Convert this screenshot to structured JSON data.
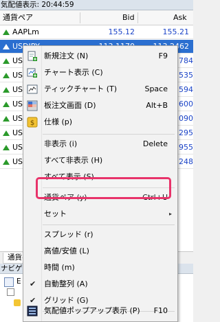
{
  "window": {
    "title": "気配値表示: 20:44:59"
  },
  "table": {
    "columns": [
      "通貨ペア",
      "Bid",
      "Ask"
    ],
    "rows": [
      {
        "symbol": "AAPLm",
        "bid": "155.12",
        "ask": "155.21",
        "selected": false
      },
      {
        "symbol": "USDJPY",
        "bid": "113.1170",
        "ask": "113.2462",
        "selected": true
      },
      {
        "symbol": "US",
        "bid": "",
        "ask": "784",
        "selected": false
      },
      {
        "symbol": "US",
        "bid": "",
        "ask": "535",
        "selected": false
      },
      {
        "symbol": "US",
        "bid": "",
        "ask": "594",
        "selected": false
      },
      {
        "symbol": "US",
        "bid": "",
        "ask": "600",
        "selected": false
      },
      {
        "symbol": "US",
        "bid": "",
        "ask": "090",
        "selected": false
      },
      {
        "symbol": "US",
        "bid": "",
        "ask": "295",
        "selected": false
      },
      {
        "symbol": "US",
        "bid": "",
        "ask": "955",
        "selected": false
      },
      {
        "symbol": "US",
        "bid": "",
        "ask": "248",
        "selected": false
      }
    ]
  },
  "bottom_tab": "通貨ペ",
  "navigator": {
    "title": "ナビゲ",
    "item": "E"
  },
  "menu": {
    "items": [
      {
        "label": "新規注文 (N)",
        "shortcut": "F9",
        "icon": "new-order-icon"
      },
      {
        "label": "チャート表示 (C)",
        "shortcut": "",
        "icon": "chart-window-icon"
      },
      {
        "label": "ティックチャート (T)",
        "shortcut": "Space",
        "icon": "tick-chart-icon"
      },
      {
        "label": "板注文画面 (D)",
        "shortcut": "Alt+B",
        "icon": "depth-of-market-icon"
      },
      {
        "label": "仕様 (p)",
        "shortcut": "",
        "icon": "specification-icon"
      },
      {
        "label": "非表示 (i)",
        "shortcut": "Delete"
      },
      {
        "label": "すべて非表示 (H)",
        "shortcut": ""
      },
      {
        "label": "すべて表示 (S)",
        "shortcut": ""
      },
      {
        "label": "通貨ペア (y)",
        "shortcut": "Ctrl+U",
        "highlighted": true
      },
      {
        "label": "セット",
        "shortcut": "",
        "submenu": true
      },
      {
        "label": "スプレッド (r)",
        "shortcut": ""
      },
      {
        "label": "高値/安値 (L)",
        "shortcut": ""
      },
      {
        "label": "時間 (m)",
        "shortcut": ""
      },
      {
        "label": "自動整列 (A)",
        "shortcut": "",
        "checked": true
      },
      {
        "label": "グリッド (G)",
        "shortcut": "",
        "checked": true
      },
      {
        "label": "気配値ポップアップ表示 (P)",
        "shortcut": "F10",
        "icon": "popup-prices-icon"
      }
    ]
  },
  "colors": {
    "selected_row": "#2b6fd0",
    "price_text": "#1b44c8",
    "highlight_border": "#e8336a",
    "up_arrow": "#2b9a2b"
  }
}
